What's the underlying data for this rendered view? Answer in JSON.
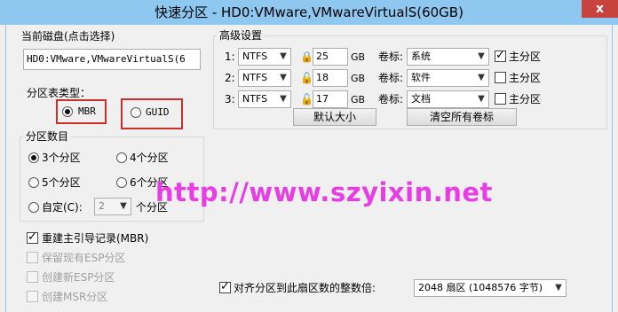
{
  "window": {
    "title": "快速分区 - HD0:VMware,VMwareVirtualS(60GB)",
    "close_glyph": "x"
  },
  "left": {
    "current_disk_label": "当前磁盘(点击选择)",
    "current_disk_value": "HD0:VMware,VMwareVirtualS(6",
    "table_type_label": "分区表类型：",
    "mbr_label": "MBR",
    "guid_label": "GUID",
    "count_group_title": "分区数目",
    "opt3": "3个分区",
    "opt4": "4个分区",
    "opt5": "5个分区",
    "opt6": "6个分区",
    "custom_label": "自定(C):",
    "custom_value": "2",
    "custom_suffix": "个分区",
    "rebuild_mbr": "重建主引导记录(MBR)",
    "keep_esp": "保留现有ESP分区",
    "new_esp": "创建新ESP分区",
    "new_msr": "创建MSR分区"
  },
  "advanced": {
    "title": "高级设置",
    "rows": [
      {
        "index": "1:",
        "fs": "NTFS",
        "size": "25",
        "unit": "GB",
        "vol_label": "卷标:",
        "volume": "系统",
        "primary_label": "主分区",
        "primary_checked": true
      },
      {
        "index": "2:",
        "fs": "NTFS",
        "size": "18",
        "unit": "GB",
        "vol_label": "卷标:",
        "volume": "软件",
        "primary_label": "主分区",
        "primary_checked": false
      },
      {
        "index": "3:",
        "fs": "NTFS",
        "size": "17",
        "unit": "GB",
        "vol_label": "卷标:",
        "volume": "文档",
        "primary_label": "主分区",
        "primary_checked": false
      }
    ],
    "default_size_button": "默认大小",
    "clear_labels_button": "清空所有卷标"
  },
  "align": {
    "label": "对齐分区到此扇区数的整数倍:",
    "value": "2048 扇区 (1048576 字节)"
  },
  "watermark": "http://www.szyixin.net",
  "colors": {
    "titlebar": "#8ec7ef",
    "close": "#c7443e",
    "highlight_box": "#c9302c",
    "watermark": "#e83ce6"
  }
}
